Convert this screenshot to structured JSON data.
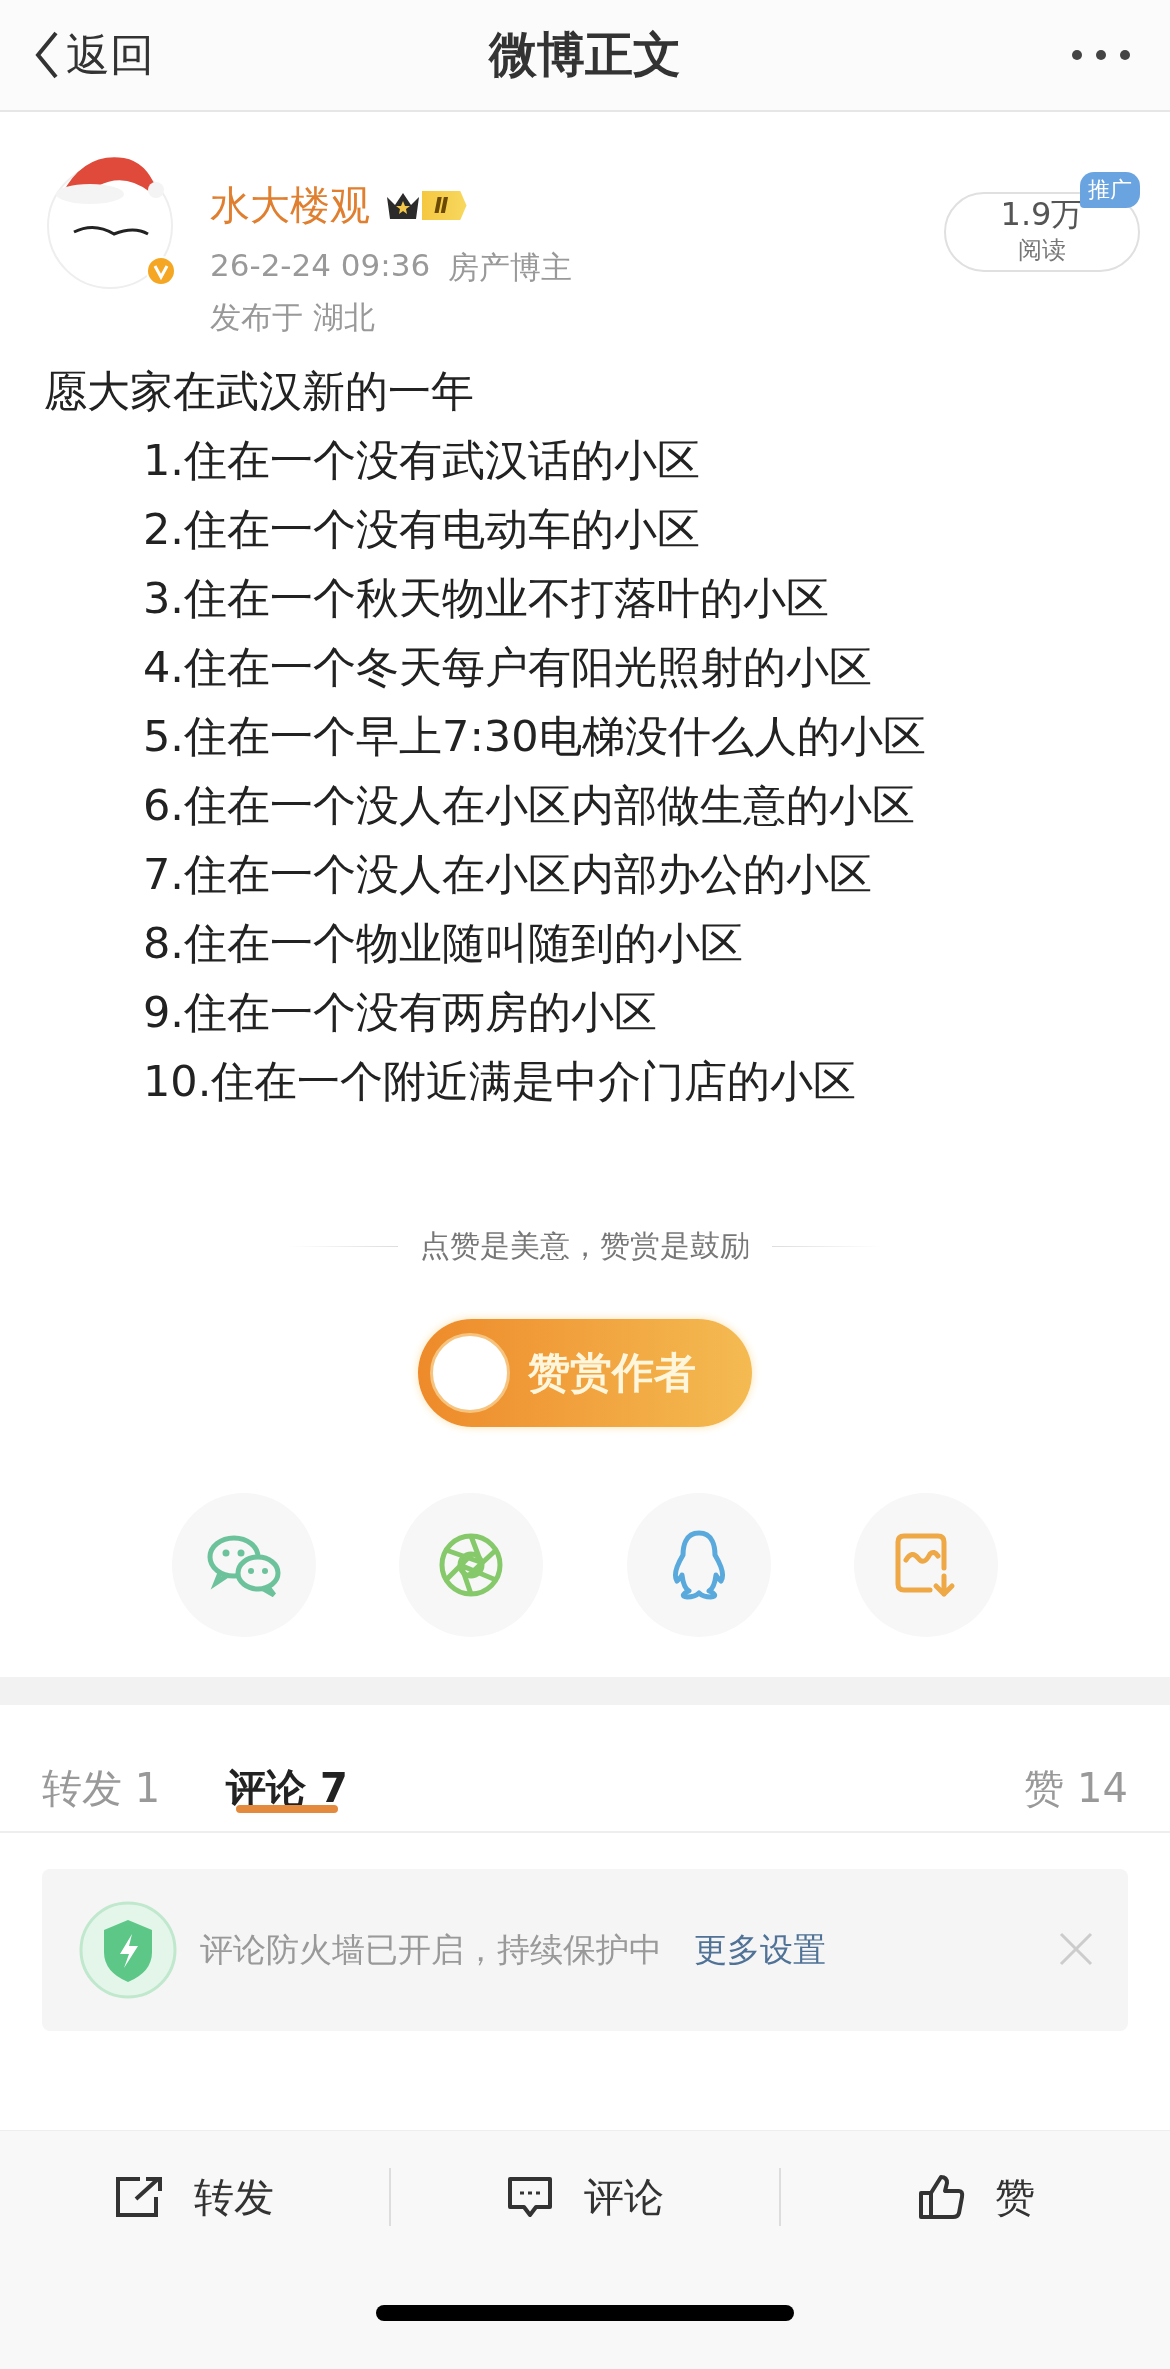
{
  "nav": {
    "back": "返回",
    "title": "微博正文"
  },
  "post": {
    "author": "水大楼观",
    "level_badge": "Ⅱ",
    "time": "26-2-24 09:36",
    "category": "房产博主",
    "location": "发布于 湖北",
    "reads": {
      "value": "1.9万",
      "label": "阅读",
      "badge": "推广"
    },
    "heading": "愿大家在武汉新的一年",
    "items": [
      "1.住在一个没有武汉话的小区",
      "2.住在一个没有电动车的小区",
      "3.住在一个秋天物业不打落叶的小区",
      "4.住在一个冬天每户有阳光照射的小区",
      "5.住在一个早上7:30电梯没什么人的小区",
      "6.住在一个没人在小区内部做生意的小区",
      "7.住在一个没人在小区内部办公的小区",
      "8.住在一个物业随叫随到的小区",
      "9.住在一个没有两房的小区",
      "10.住在一个附近满是中介门店的小区"
    ]
  },
  "reward": {
    "slogan": "点赞是美意，赞赏是鼓励",
    "button": "赞赏作者"
  },
  "share": [
    {
      "kind": "wechat"
    },
    {
      "kind": "moments"
    },
    {
      "kind": "qq"
    },
    {
      "kind": "save-image"
    }
  ],
  "tabs": [
    {
      "label": "转发 1",
      "selected": false
    },
    {
      "label": "评论 7",
      "selected": true
    },
    {
      "label": "赞 14",
      "selected": false
    }
  ],
  "notice": {
    "text": "评论防火墙已开启，持续保护中",
    "link": "更多设置"
  },
  "actions": [
    {
      "kind": "repost",
      "label": "转发"
    },
    {
      "kind": "comment",
      "label": "评论"
    },
    {
      "kind": "like",
      "label": "赞"
    }
  ]
}
